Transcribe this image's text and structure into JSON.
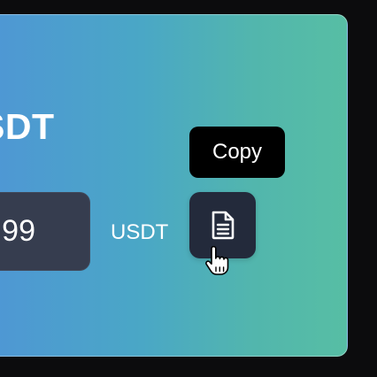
{
  "card": {
    "title": "SDT",
    "amount_value": "99",
    "unit": "USDT"
  },
  "tooltip": {
    "text": "Copy"
  },
  "copy_button": {
    "icon": "document-icon"
  },
  "cursor": {
    "icon": "hand-pointer-icon"
  },
  "colors": {
    "background": "#0c0c0d",
    "card_gradient_start": "#4f95d6",
    "card_gradient_end": "#57bea4",
    "input_background": "#363d4f",
    "button_background": "#232a3b",
    "tooltip_background": "#000000",
    "text": "#ffffff"
  }
}
